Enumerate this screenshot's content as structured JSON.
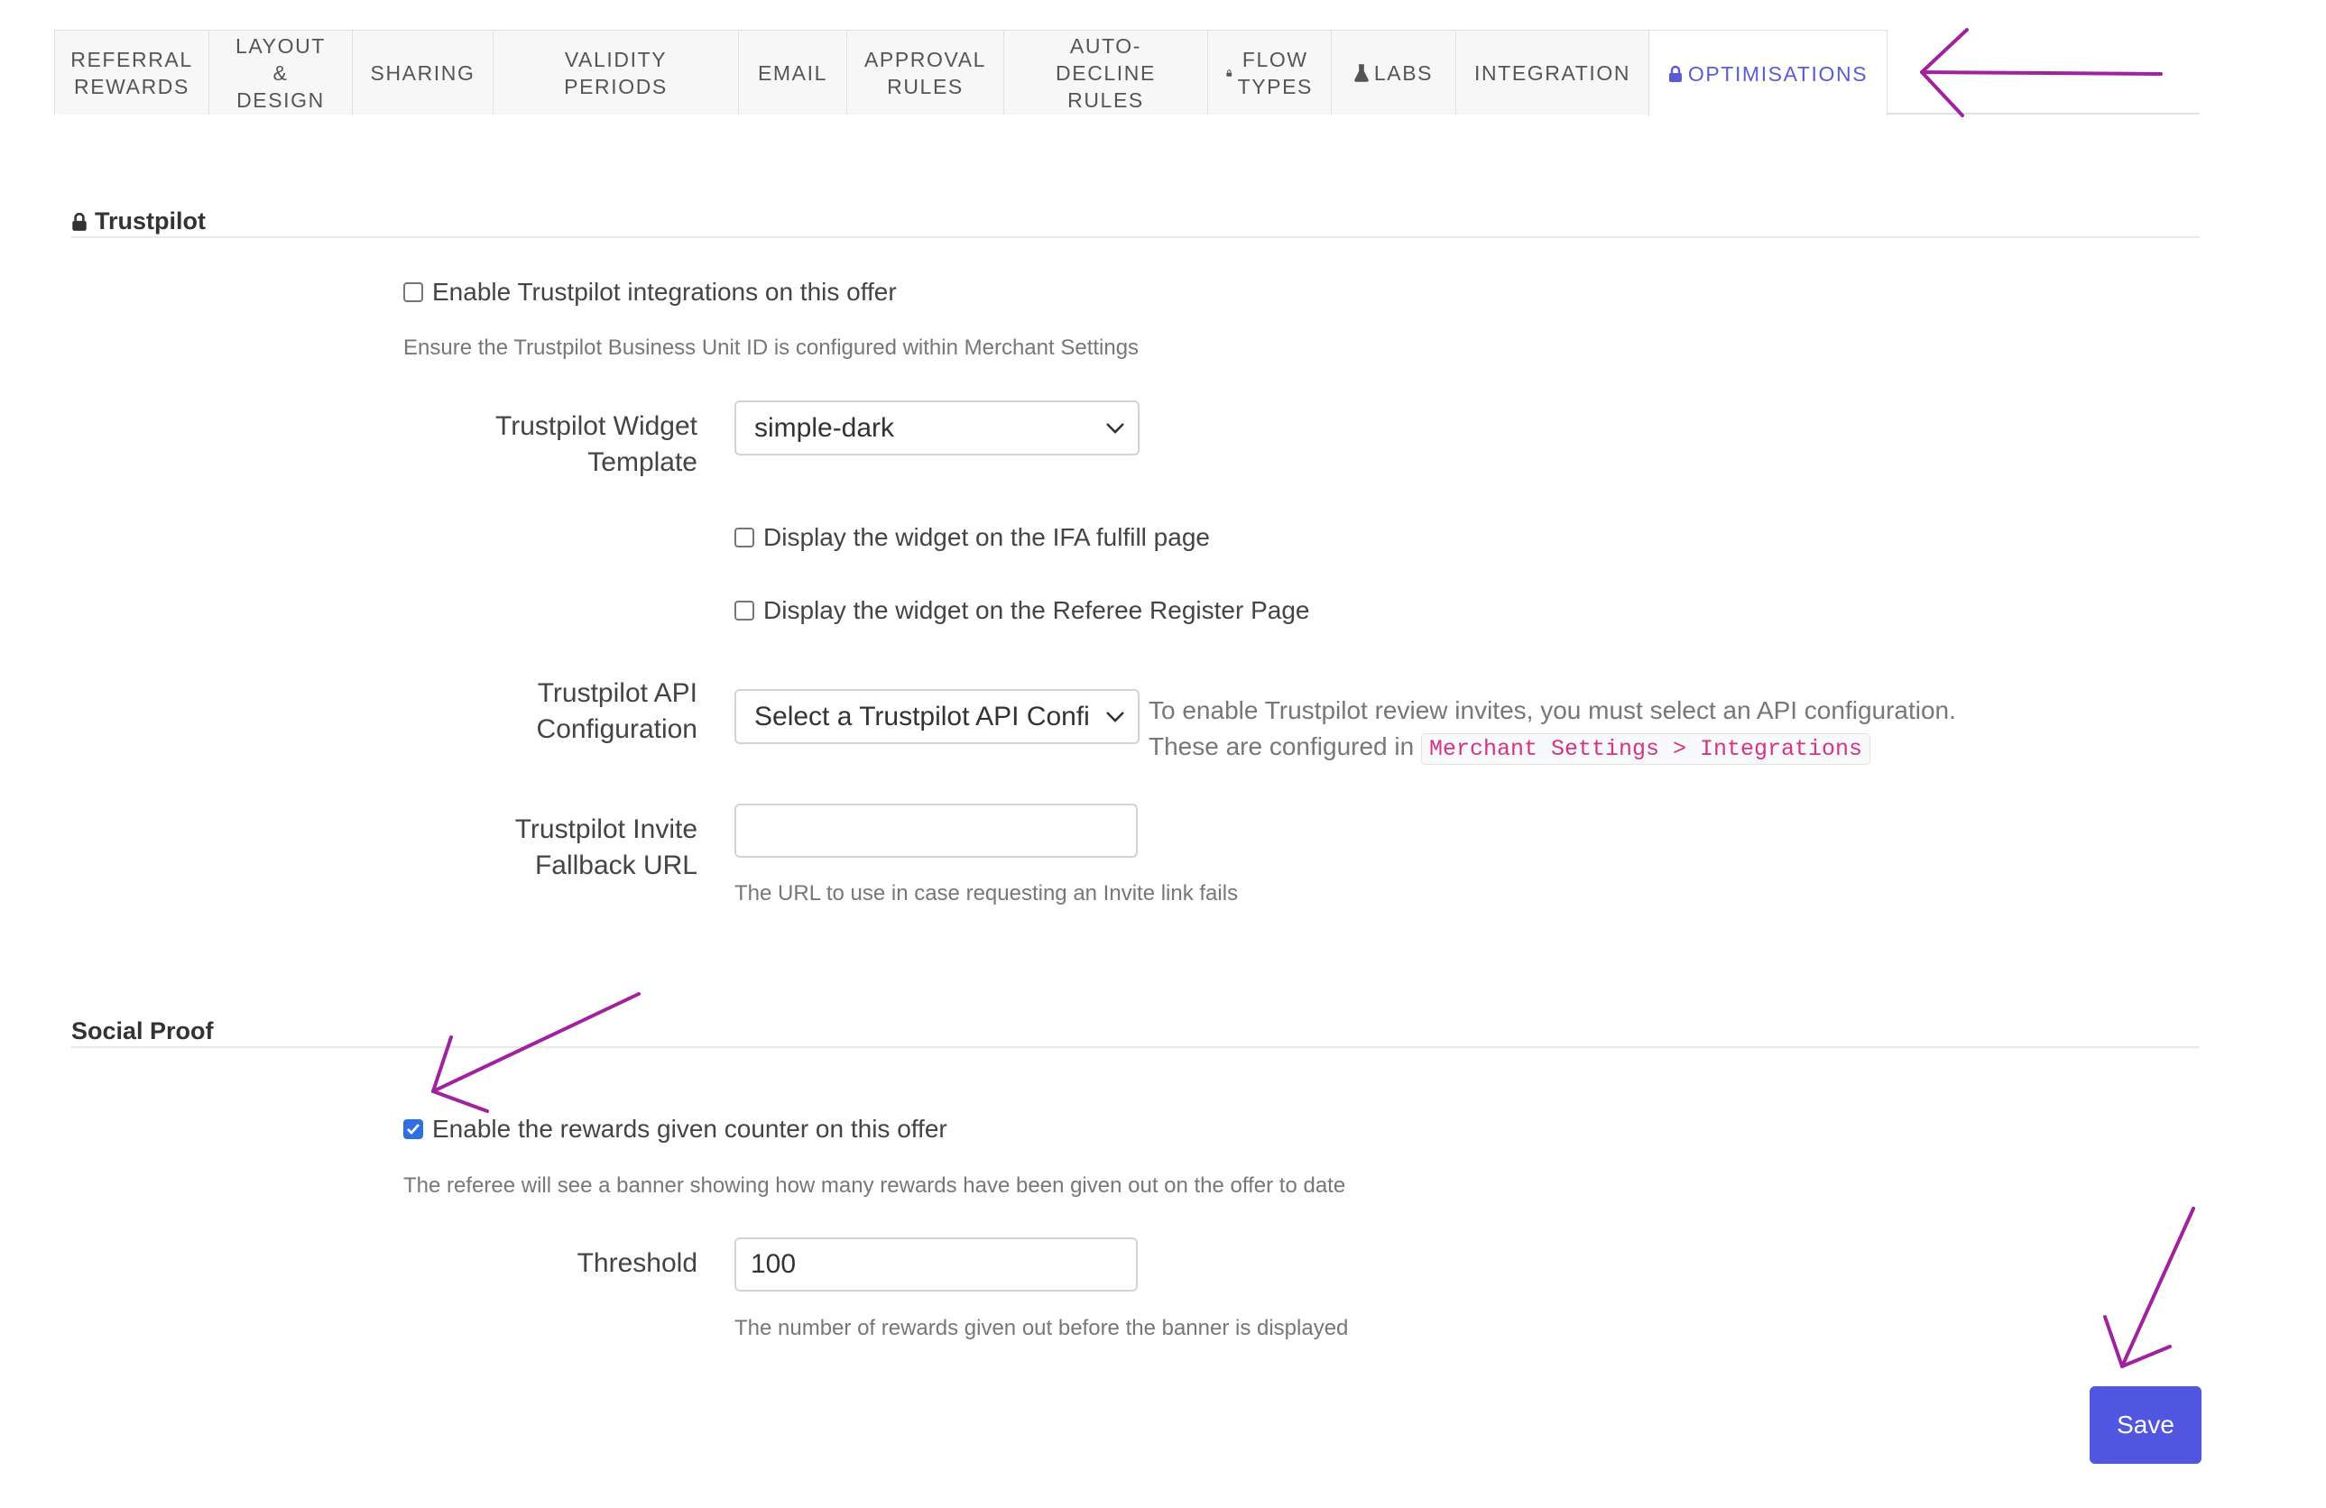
{
  "tabs": [
    {
      "label": "Referral\nRewards"
    },
    {
      "label": "Layout\n& Design"
    },
    {
      "label": "Sharing"
    },
    {
      "label": "Validity Periods"
    },
    {
      "label": "Email"
    },
    {
      "label": "Approval\nRules"
    },
    {
      "label": "Auto-Decline\nRules"
    },
    {
      "label": "Flow\nTypes"
    },
    {
      "label": "Labs"
    },
    {
      "label": "Integration"
    },
    {
      "label": "Optimisations"
    }
  ],
  "trustpilot": {
    "title": "Trustpilot",
    "enable_label": "Enable Trustpilot integrations on this offer",
    "enable_checked": false,
    "enable_help": "Ensure the Trustpilot Business Unit ID is configured within Merchant Settings",
    "widget_template_label": "Trustpilot Widget Template",
    "widget_template_value": "simple-dark",
    "ifa_label": "Display the widget on the IFA fulfill page",
    "referee_label": "Display the widget on the Referee Register Page",
    "api_label": "Trustpilot API Configuration",
    "api_value": "Select a Trustpilot API Confi",
    "api_desc_line1": "To enable Trustpilot review invites, you must select an API configuration.",
    "api_desc_line2": "These are configured in",
    "api_desc_code": "Merchant Settings > Integrations",
    "fallback_label": "Trustpilot Invite Fallback URL",
    "fallback_value": "",
    "fallback_help": "The URL to use in case requesting an Invite link fails"
  },
  "social_proof": {
    "title": "Social Proof",
    "enable_label": "Enable the rewards given counter on this offer",
    "enable_checked": true,
    "enable_help": "The referee will see a banner showing how many rewards have been given out on the offer to date",
    "threshold_label": "Threshold",
    "threshold_value": "100",
    "threshold_help": "The number of rewards given out before the banner is displayed"
  },
  "save_label": "Save",
  "colors": {
    "accent": "#5056e0",
    "annotation": "#a0229e",
    "checkbox": "#2f6fe0"
  },
  "icons": {
    "lock": "lock-icon",
    "flask": "flask-icon",
    "chevron": "chevron-down-icon",
    "check": "check-icon"
  }
}
